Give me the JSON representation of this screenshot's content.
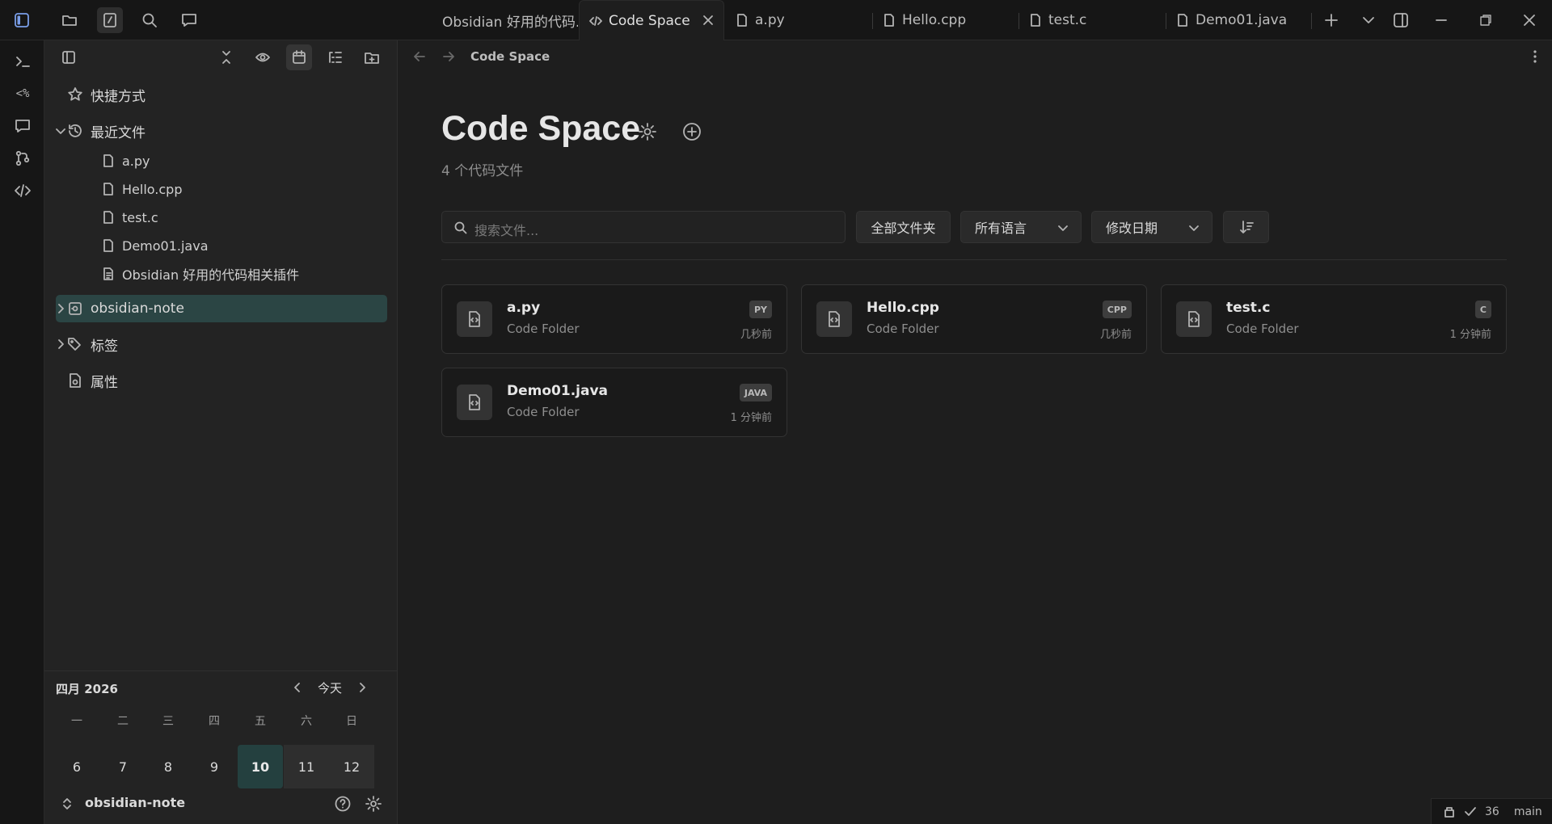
{
  "tabs": [
    {
      "label": "Obsidian 好用的代码...",
      "icon": "none"
    },
    {
      "label": "Code Space",
      "icon": "code-icon"
    },
    {
      "label": "a.py",
      "icon": "file-icon"
    },
    {
      "label": "Hello.cpp",
      "icon": "file-icon"
    },
    {
      "label": "test.c",
      "icon": "file-icon"
    },
    {
      "label": "Demo01.java",
      "icon": "file-icon"
    }
  ],
  "ribbon": {
    "templater_label": "<%"
  },
  "sidebar": {
    "shortcuts_label": "快捷方式",
    "recent_label": "最近文件",
    "recent_files": [
      "a.py",
      "Hello.cpp",
      "test.c",
      "Demo01.java",
      "Obsidian 好用的代码相关插件"
    ],
    "vault_folder": "obsidian-note",
    "tags_label": "标签",
    "properties_label": "属性"
  },
  "calendar": {
    "title": "四月 2026",
    "today_label": "今天",
    "weekdays": [
      "一",
      "二",
      "三",
      "四",
      "五",
      "六",
      "日"
    ],
    "days": [
      "6",
      "7",
      "8",
      "9",
      "10",
      "11",
      "12"
    ],
    "today": "10"
  },
  "vault_bar": {
    "name": "obsidian-note"
  },
  "main": {
    "breadcrumb": "Code Space",
    "title": "Code Space",
    "subtitle": "4 个代码文件",
    "search_placeholder": "搜索文件...",
    "filter_folder": "全部文件夹",
    "filter_language": "所有语言",
    "filter_sort": "修改日期",
    "cards": [
      {
        "name": "a.py",
        "folder": "Code Folder",
        "badge": "PY",
        "time": "几秒前"
      },
      {
        "name": "Hello.cpp",
        "folder": "Code Folder",
        "badge": "CPP",
        "time": "几秒前"
      },
      {
        "name": "test.c",
        "folder": "Code Folder",
        "badge": "C",
        "time": "1 分钟前"
      },
      {
        "name": "Demo01.java",
        "folder": "Code Folder",
        "badge": "JAVA",
        "time": "1 分钟前"
      }
    ]
  },
  "status": {
    "count": "36",
    "branch": "main"
  },
  "colors": {
    "accent": "#2b4544",
    "background": "#1e1e1e",
    "sidebar": "#232323"
  }
}
